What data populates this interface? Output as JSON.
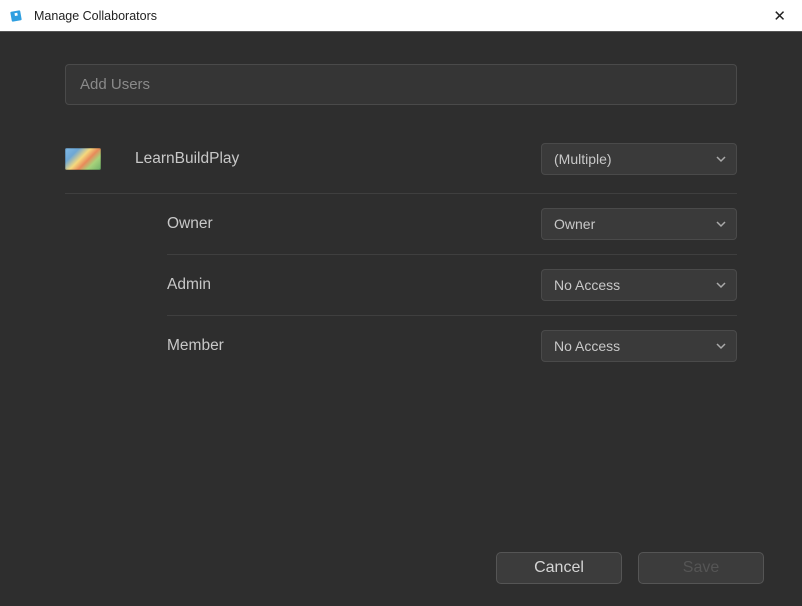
{
  "window": {
    "title": "Manage Collaborators",
    "close": "✕"
  },
  "search": {
    "placeholder": "Add Users"
  },
  "group": {
    "name": "LearnBuildPlay",
    "access": "(Multiple)"
  },
  "roles": [
    {
      "label": "Owner",
      "value": "Owner"
    },
    {
      "label": "Admin",
      "value": "No Access"
    },
    {
      "label": "Member",
      "value": "No Access"
    }
  ],
  "buttons": {
    "cancel": "Cancel",
    "save": "Save"
  }
}
